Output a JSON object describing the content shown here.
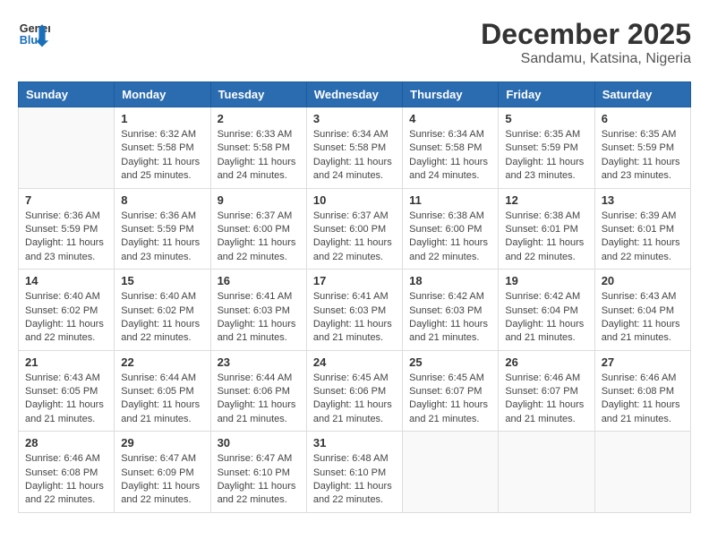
{
  "logo": {
    "line1": "General",
    "line2": "Blue"
  },
  "title": "December 2025",
  "subtitle": "Sandamu, Katsina, Nigeria",
  "days_of_week": [
    "Sunday",
    "Monday",
    "Tuesday",
    "Wednesday",
    "Thursday",
    "Friday",
    "Saturday"
  ],
  "weeks": [
    [
      {
        "day": "",
        "info": ""
      },
      {
        "day": "1",
        "info": "Sunrise: 6:32 AM\nSunset: 5:58 PM\nDaylight: 11 hours\nand 25 minutes."
      },
      {
        "day": "2",
        "info": "Sunrise: 6:33 AM\nSunset: 5:58 PM\nDaylight: 11 hours\nand 24 minutes."
      },
      {
        "day": "3",
        "info": "Sunrise: 6:34 AM\nSunset: 5:58 PM\nDaylight: 11 hours\nand 24 minutes."
      },
      {
        "day": "4",
        "info": "Sunrise: 6:34 AM\nSunset: 5:58 PM\nDaylight: 11 hours\nand 24 minutes."
      },
      {
        "day": "5",
        "info": "Sunrise: 6:35 AM\nSunset: 5:59 PM\nDaylight: 11 hours\nand 23 minutes."
      },
      {
        "day": "6",
        "info": "Sunrise: 6:35 AM\nSunset: 5:59 PM\nDaylight: 11 hours\nand 23 minutes."
      }
    ],
    [
      {
        "day": "7",
        "info": "Sunrise: 6:36 AM\nSunset: 5:59 PM\nDaylight: 11 hours\nand 23 minutes."
      },
      {
        "day": "8",
        "info": "Sunrise: 6:36 AM\nSunset: 5:59 PM\nDaylight: 11 hours\nand 23 minutes."
      },
      {
        "day": "9",
        "info": "Sunrise: 6:37 AM\nSunset: 6:00 PM\nDaylight: 11 hours\nand 22 minutes."
      },
      {
        "day": "10",
        "info": "Sunrise: 6:37 AM\nSunset: 6:00 PM\nDaylight: 11 hours\nand 22 minutes."
      },
      {
        "day": "11",
        "info": "Sunrise: 6:38 AM\nSunset: 6:00 PM\nDaylight: 11 hours\nand 22 minutes."
      },
      {
        "day": "12",
        "info": "Sunrise: 6:38 AM\nSunset: 6:01 PM\nDaylight: 11 hours\nand 22 minutes."
      },
      {
        "day": "13",
        "info": "Sunrise: 6:39 AM\nSunset: 6:01 PM\nDaylight: 11 hours\nand 22 minutes."
      }
    ],
    [
      {
        "day": "14",
        "info": "Sunrise: 6:40 AM\nSunset: 6:02 PM\nDaylight: 11 hours\nand 22 minutes."
      },
      {
        "day": "15",
        "info": "Sunrise: 6:40 AM\nSunset: 6:02 PM\nDaylight: 11 hours\nand 22 minutes."
      },
      {
        "day": "16",
        "info": "Sunrise: 6:41 AM\nSunset: 6:03 PM\nDaylight: 11 hours\nand 21 minutes."
      },
      {
        "day": "17",
        "info": "Sunrise: 6:41 AM\nSunset: 6:03 PM\nDaylight: 11 hours\nand 21 minutes."
      },
      {
        "day": "18",
        "info": "Sunrise: 6:42 AM\nSunset: 6:03 PM\nDaylight: 11 hours\nand 21 minutes."
      },
      {
        "day": "19",
        "info": "Sunrise: 6:42 AM\nSunset: 6:04 PM\nDaylight: 11 hours\nand 21 minutes."
      },
      {
        "day": "20",
        "info": "Sunrise: 6:43 AM\nSunset: 6:04 PM\nDaylight: 11 hours\nand 21 minutes."
      }
    ],
    [
      {
        "day": "21",
        "info": "Sunrise: 6:43 AM\nSunset: 6:05 PM\nDaylight: 11 hours\nand 21 minutes."
      },
      {
        "day": "22",
        "info": "Sunrise: 6:44 AM\nSunset: 6:05 PM\nDaylight: 11 hours\nand 21 minutes."
      },
      {
        "day": "23",
        "info": "Sunrise: 6:44 AM\nSunset: 6:06 PM\nDaylight: 11 hours\nand 21 minutes."
      },
      {
        "day": "24",
        "info": "Sunrise: 6:45 AM\nSunset: 6:06 PM\nDaylight: 11 hours\nand 21 minutes."
      },
      {
        "day": "25",
        "info": "Sunrise: 6:45 AM\nSunset: 6:07 PM\nDaylight: 11 hours\nand 21 minutes."
      },
      {
        "day": "26",
        "info": "Sunrise: 6:46 AM\nSunset: 6:07 PM\nDaylight: 11 hours\nand 21 minutes."
      },
      {
        "day": "27",
        "info": "Sunrise: 6:46 AM\nSunset: 6:08 PM\nDaylight: 11 hours\nand 21 minutes."
      }
    ],
    [
      {
        "day": "28",
        "info": "Sunrise: 6:46 AM\nSunset: 6:08 PM\nDaylight: 11 hours\nand 22 minutes."
      },
      {
        "day": "29",
        "info": "Sunrise: 6:47 AM\nSunset: 6:09 PM\nDaylight: 11 hours\nand 22 minutes."
      },
      {
        "day": "30",
        "info": "Sunrise: 6:47 AM\nSunset: 6:10 PM\nDaylight: 11 hours\nand 22 minutes."
      },
      {
        "day": "31",
        "info": "Sunrise: 6:48 AM\nSunset: 6:10 PM\nDaylight: 11 hours\nand 22 minutes."
      },
      {
        "day": "",
        "info": ""
      },
      {
        "day": "",
        "info": ""
      },
      {
        "day": "",
        "info": ""
      }
    ]
  ]
}
